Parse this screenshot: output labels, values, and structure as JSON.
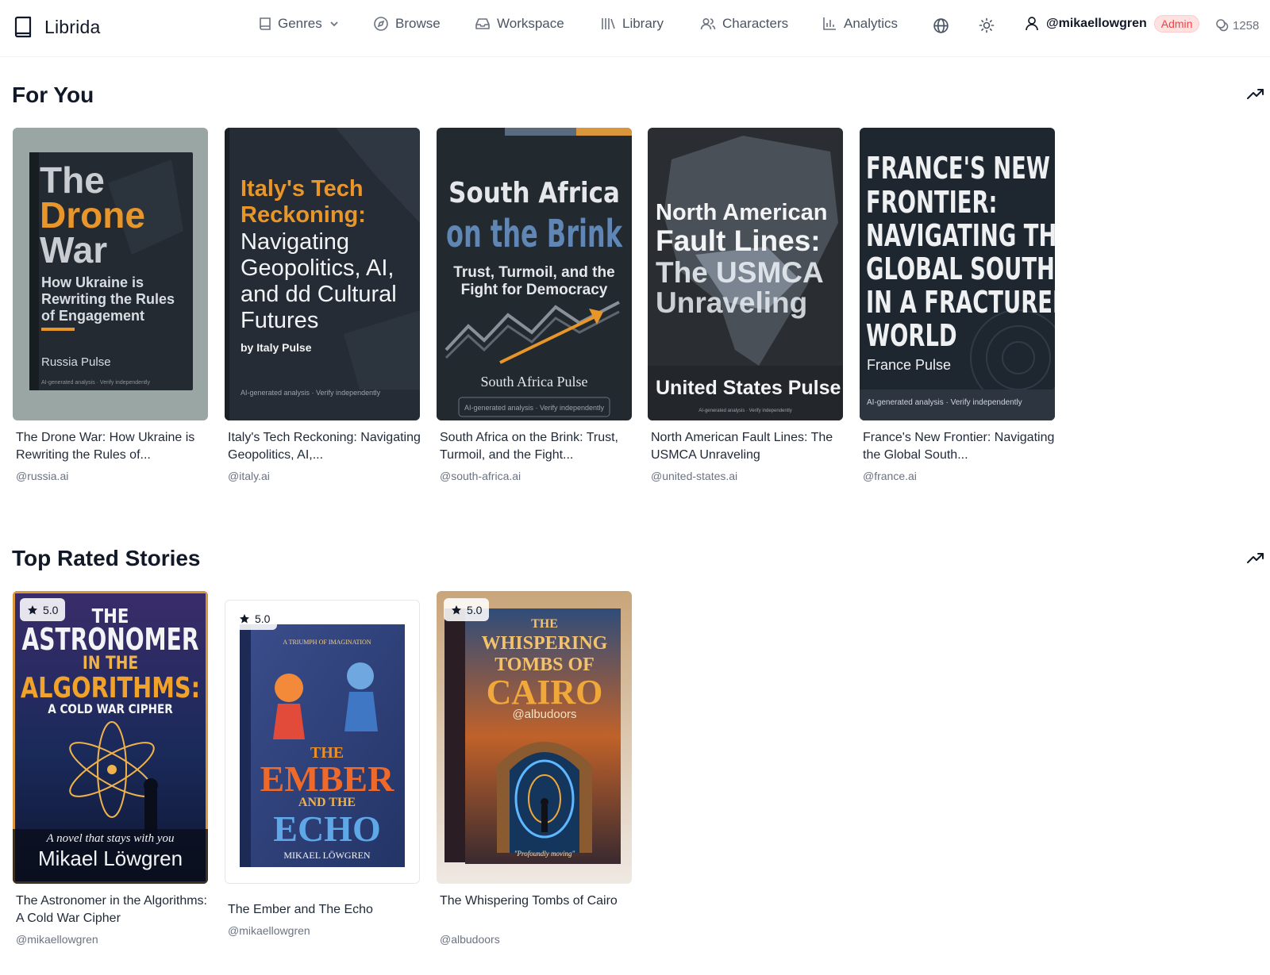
{
  "app": {
    "name": "Librida"
  },
  "nav": {
    "genres": "Genres",
    "browse": "Browse",
    "workspace": "Workspace",
    "library": "Library",
    "characters": "Characters",
    "analytics": "Analytics"
  },
  "user": {
    "handle": "@mikaellowgren",
    "role": "Admin",
    "credits": "1258"
  },
  "icons": [
    "book-icon",
    "genres-book-icon",
    "chevron-down-icon",
    "compass-icon",
    "inbox-icon",
    "library-icon",
    "users-icon",
    "bar-chart-icon",
    "globe-icon",
    "sun-icon",
    "user-icon",
    "credits-icon",
    "trending-up-icon",
    "star-icon"
  ],
  "sections": [
    {
      "title": "For You",
      "books": [
        {
          "title": "The Drone War: How Ukraine is Rewriting the Rules of...",
          "author": "@russia.ai",
          "cover": {
            "heading": [
              "The",
              "Drone",
              "War"
            ],
            "sub": [
              "How Ukraine is",
              "Rewriting the Rules",
              "of Engagement"
            ],
            "publisher": "Russia Pulse",
            "footer": "AI-generated analysis · Verify independently"
          }
        },
        {
          "title": "Italy's Tech Reckoning: Navigating Geopolitics, AI,...",
          "author": "@italy.ai",
          "cover": {
            "heading": [
              "Italy's Tech",
              "Reckoning:"
            ],
            "sub": [
              "Navigating",
              "Geopolitics, AI,",
              "and dd Cultural",
              "Futures"
            ],
            "publisher": "by Italy Pulse",
            "footer": "AI-generated analysis · Verify independently"
          }
        },
        {
          "title": "South Africa on the Brink: Trust, Turmoil, and the Fight...",
          "author": "@south-africa.ai",
          "cover": {
            "heading": [
              "South Africa",
              "on the Brink"
            ],
            "sub": [
              "Trust, Turmoil, and the",
              "Fight for Democracy"
            ],
            "publisher": "South Africa Pulse",
            "footer": "AI-generated analysis · Verify independently"
          }
        },
        {
          "title": "North American Fault Lines: The USMCA Unraveling",
          "author": "@united-states.ai",
          "cover": {
            "heading": [
              "North American",
              "Fault Lines:",
              "The USMCA",
              "Unraveling"
            ],
            "publisher": "United States Pulse",
            "footer": "AI-generated analysis · Verify independently"
          }
        },
        {
          "title": "France's New Frontier: Navigating the Global South...",
          "author": "@france.ai",
          "cover": {
            "heading": [
              "FRANCE'S NEW",
              "FRONTIER:",
              "NAVIGATING THE",
              "GLOBAL SOUTH",
              "IN A FRACTURED",
              "WORLD"
            ],
            "publisher": "France Pulse",
            "footer": "AI-generated analysis · Verify independently"
          }
        }
      ]
    },
    {
      "title": "Top Rated Stories",
      "books": [
        {
          "title": "The Astronomer in the Algorithms: A Cold War Cipher",
          "author": "@mikaellowgren",
          "rating": "5.0",
          "cover": {
            "heading": [
              "THE",
              "ASTRONOMER",
              "IN THE",
              "ALGORITHMS:",
              "A COLD WAR CIPHER"
            ],
            "tagline": "A novel that stays with you",
            "byline": "Mikael Löwgren"
          }
        },
        {
          "title": "The Ember and The Echo",
          "author": "@mikaellowgren",
          "rating": "5.0",
          "cover": {
            "top": "A TRIUMPH OF IMAGINATION",
            "heading": [
              "THE",
              "EMBER",
              "AND THE",
              "ECHO"
            ],
            "byline": "MIKAEL LÖWGREN"
          }
        },
        {
          "title": "The Whispering Tombs of Cairo",
          "author": "@albudoors",
          "rating": "5.0",
          "cover": {
            "heading": [
              "THE",
              "WHISPERING",
              "TOMBS OF",
              "CAIRO"
            ],
            "byline": "@albudoors",
            "quote": "\"Profoundly moving\""
          }
        }
      ]
    }
  ],
  "colors": {
    "accent_orange": "#e8952a",
    "admin_red": "#ef4444",
    "admin_bg": "#fee2e2",
    "cover_dark": "#1f2733"
  }
}
